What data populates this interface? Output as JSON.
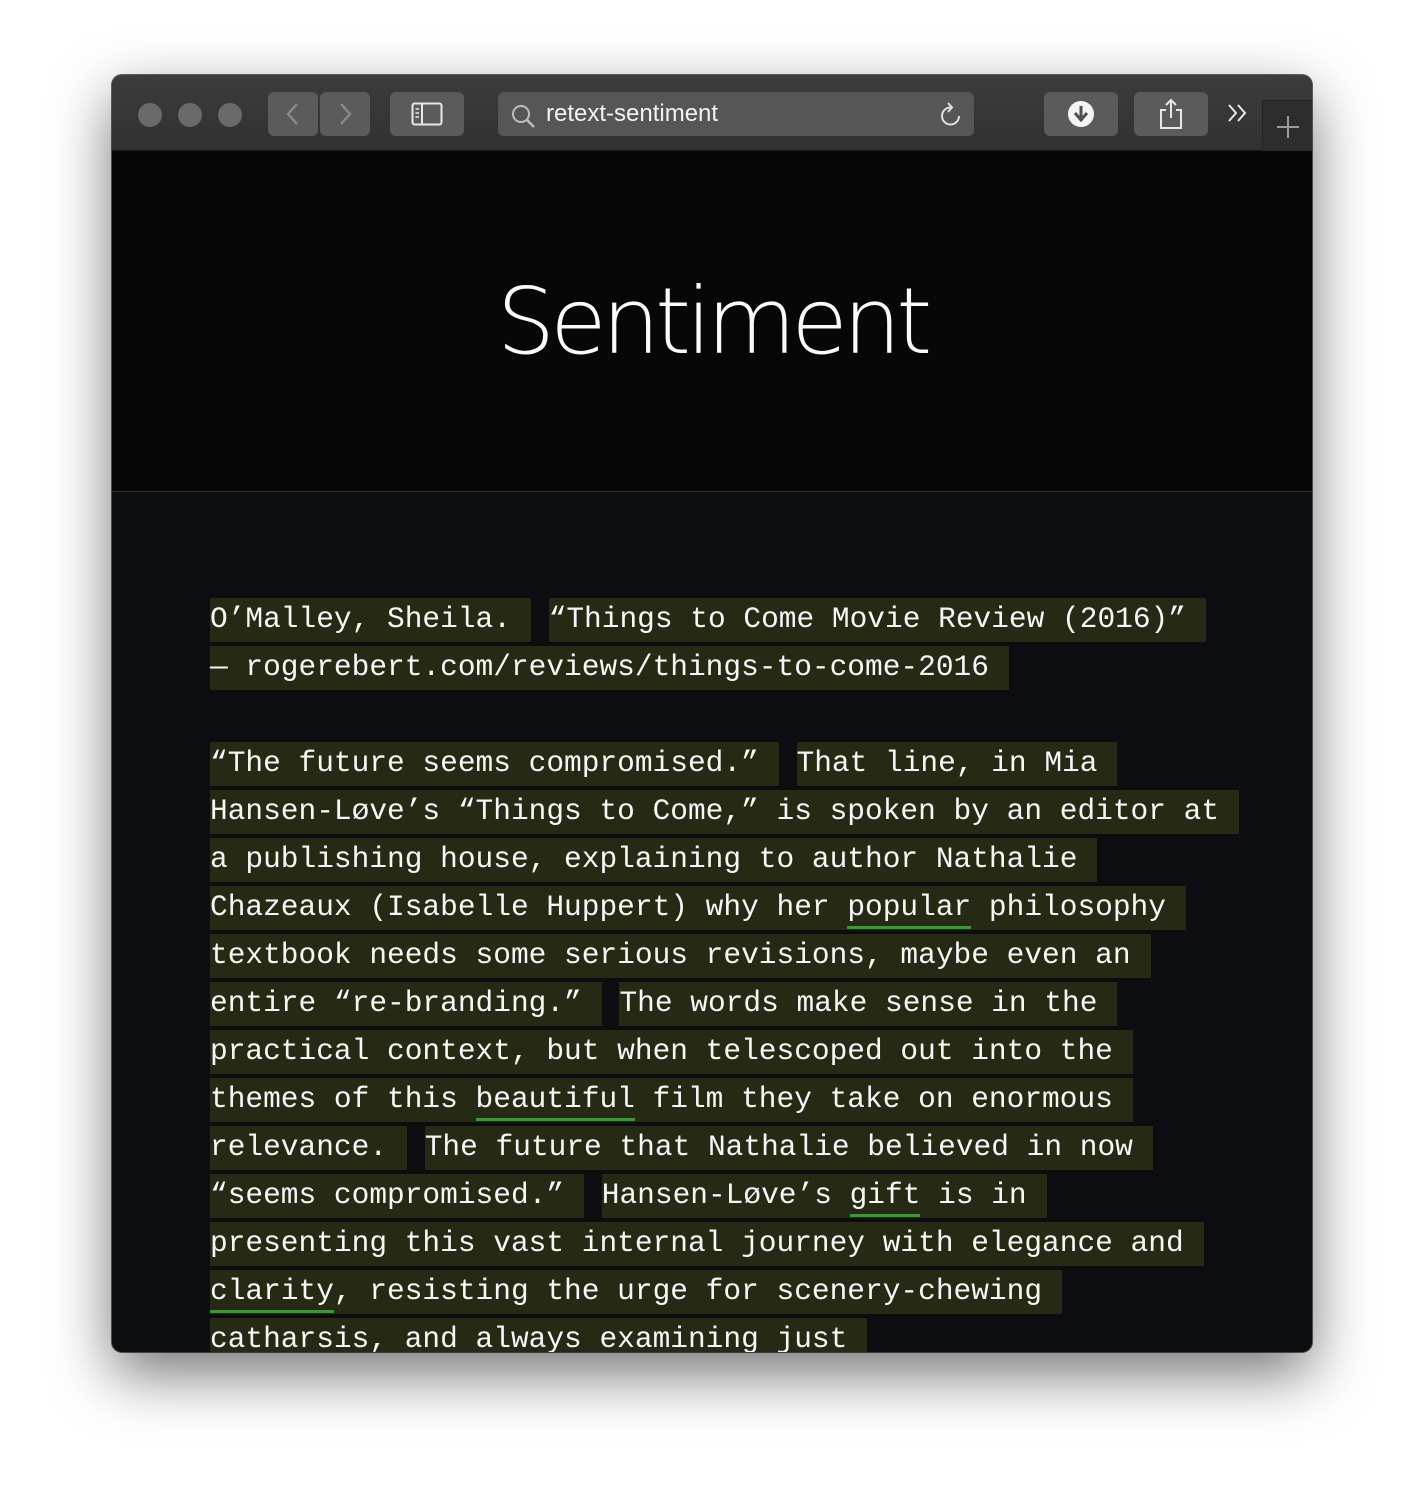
{
  "browser": {
    "address": "retext-sentiment",
    "colors": {
      "toolbar": "#383838",
      "button": "#5b5b5b",
      "page_bg": "#0c0d10"
    },
    "icons": {
      "back": "chevron-left-icon",
      "forward": "chevron-right-icon",
      "sidebar": "sidebar-icon",
      "search": "search-icon",
      "reload": "reload-icon",
      "downloads": "download-icon",
      "share": "share-icon",
      "more": "chevron-double-right-icon",
      "new_tab": "plus-icon"
    }
  },
  "page": {
    "title": "Sentiment",
    "highlight_color": "#262a14",
    "positive_underline_color": "#44933a",
    "citation": [
      {
        "text": "O’Malley, Sheila."
      },
      {
        "text": "“Things to Come Movie Review (2016)” — rogerebert.com/reviews/things-to-come-2016"
      }
    ],
    "body": [
      [
        {
          "t": "“The future seems compromised.”"
        }
      ],
      [
        {
          "t": "That line, in Mia Hansen-Løve’s “Things to Come,” is spoken by an editor at a publishing house, explaining to author Nathalie Chazeaux (Isabelle Huppert) why her "
        },
        {
          "t": "popular",
          "positive": true
        },
        {
          "t": " philosophy textbook needs some serious revisions, maybe even an entire “re-branding.”"
        }
      ],
      [
        {
          "t": "The words make sense in the practical context, but when telescoped out into the themes of this "
        },
        {
          "t": "beautiful",
          "positive": true
        },
        {
          "t": " film they take on enormous relevance."
        }
      ],
      [
        {
          "t": "The future that Nathalie believed in now “seems compromised.”"
        }
      ],
      [
        {
          "t": "Hansen-Løve’s "
        },
        {
          "t": "gift",
          "positive": true
        },
        {
          "t": " is in presenting this vast internal journey with elegance and "
        },
        {
          "t": "clarity",
          "positive": true
        },
        {
          "t": ", resisting the urge for scenery-chewing catharsis, and always examining just"
        }
      ]
    ]
  }
}
